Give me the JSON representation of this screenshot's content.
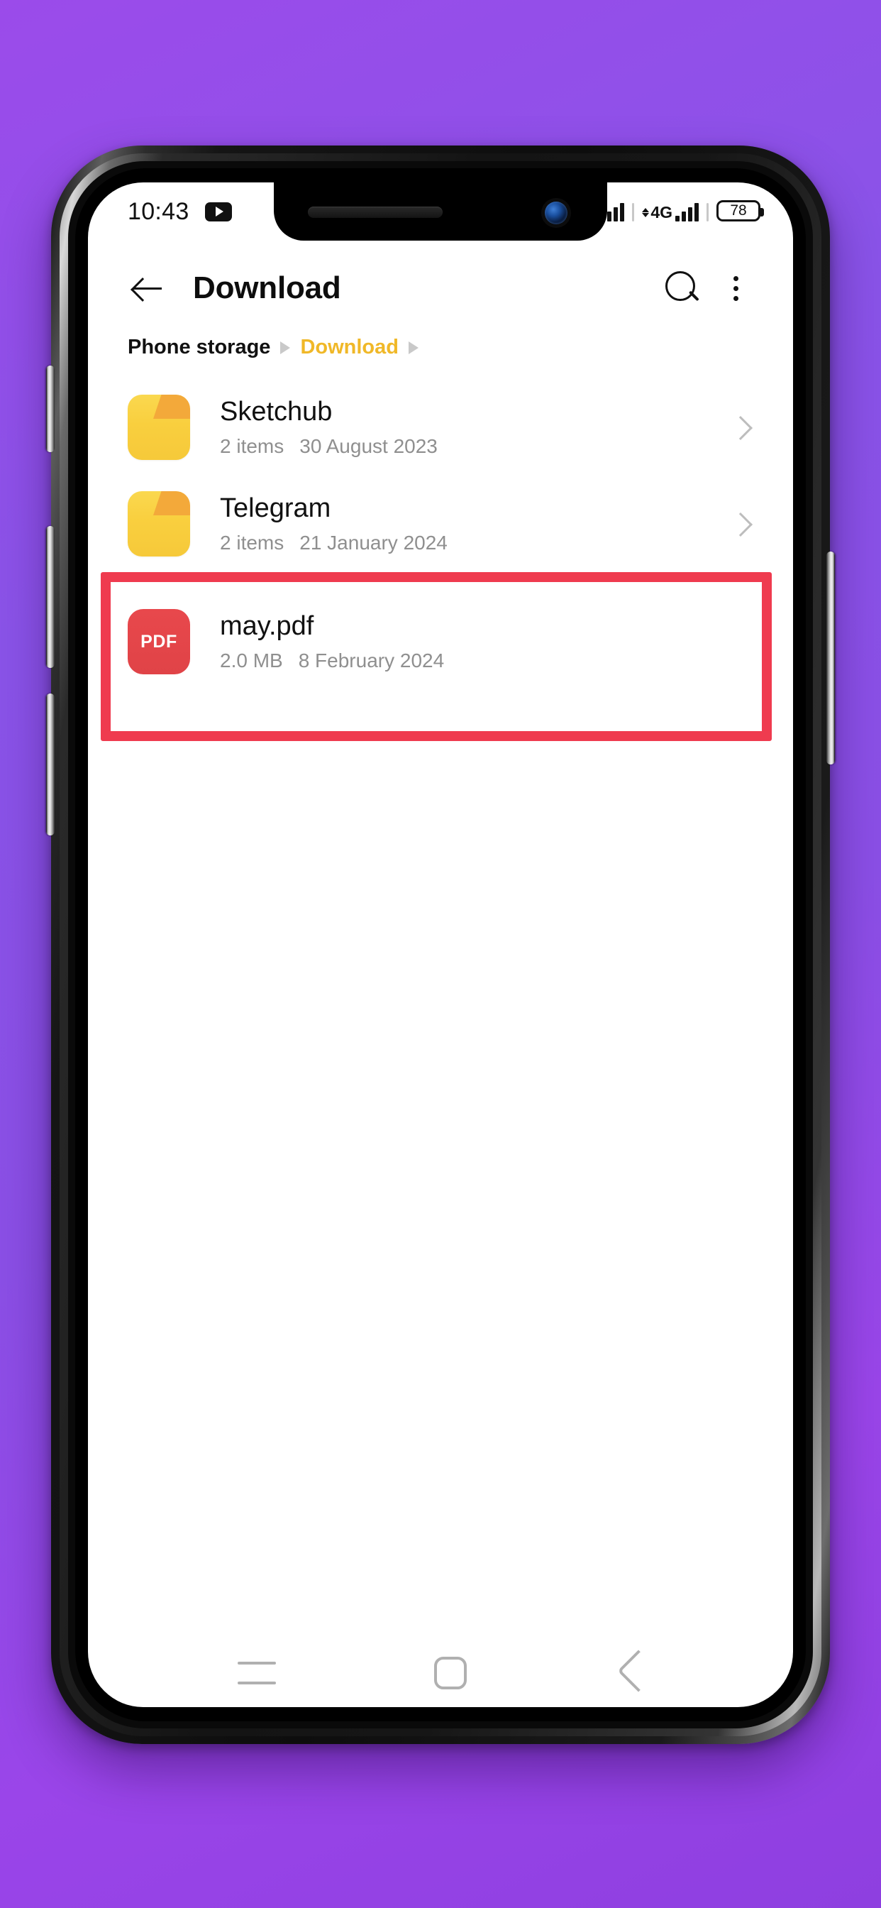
{
  "status_bar": {
    "time": "10:43",
    "notification_icon": "youtube-icon",
    "signal_icon": "signal-bars-icon",
    "network_label": "4G",
    "network_arrows_icon": "data-transfer-arrows-icon",
    "battery_percent": "78"
  },
  "app_bar": {
    "back_icon": "back-arrow-icon",
    "title": "Download",
    "search_icon": "search-icon",
    "more_icon": "overflow-menu-icon"
  },
  "breadcrumb": {
    "items": [
      {
        "label": "Phone storage",
        "active": false
      },
      {
        "label": "Download",
        "active": true
      }
    ],
    "separator_icon": "chevron-right-triangle-icon",
    "active_color": "#f0b828"
  },
  "file_list": [
    {
      "name": "Sketchub",
      "type": "folder",
      "icon": "folder-icon",
      "meta_primary": "2 items",
      "meta_secondary": "30 August 2023",
      "chevron_icon": "chevron-right-icon",
      "highlighted": false
    },
    {
      "name": "Telegram",
      "type": "folder",
      "icon": "folder-icon",
      "meta_primary": "2 items",
      "meta_secondary": "21 January 2024",
      "chevron_icon": "chevron-right-icon",
      "highlighted": false
    },
    {
      "name": "may.pdf",
      "type": "pdf",
      "icon": "pdf-file-icon",
      "icon_label": "PDF",
      "meta_primary": "2.0 MB",
      "meta_secondary": "8 February 2024",
      "chevron_icon": "",
      "highlighted": true
    }
  ],
  "annotation": {
    "color": "#ef3b4f",
    "target": "may.pdf"
  },
  "nav_bar": {
    "recents_icon": "recents-icon",
    "home_icon": "home-icon",
    "back_icon": "back-nav-icon"
  },
  "device": {
    "notch_speaker_icon": "earpiece-speaker",
    "notch_camera_icon": "front-camera",
    "background_color": "#8e4be8"
  }
}
